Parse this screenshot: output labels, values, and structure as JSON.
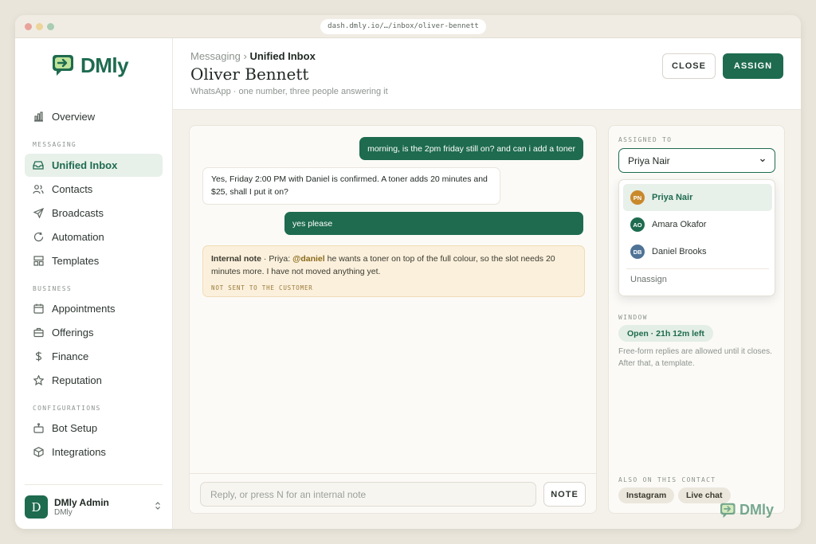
{
  "browser": {
    "url": "dash.dmly.io/…/inbox/oliver-bennett"
  },
  "brand": {
    "name": "DMly",
    "accent": "#1e6b4f"
  },
  "sidebar": {
    "top_items": [
      {
        "label": "Overview",
        "icon": "bar-chart-icon"
      }
    ],
    "sections": [
      {
        "label": "MESSAGING",
        "items": [
          {
            "label": "Unified Inbox",
            "icon": "inbox-icon",
            "active": true
          },
          {
            "label": "Contacts",
            "icon": "users-icon"
          },
          {
            "label": "Broadcasts",
            "icon": "send-icon"
          },
          {
            "label": "Automation",
            "icon": "refresh-icon"
          },
          {
            "label": "Templates",
            "icon": "layout-icon"
          }
        ]
      },
      {
        "label": "BUSINESS",
        "items": [
          {
            "label": "Appointments",
            "icon": "calendar-icon"
          },
          {
            "label": "Offerings",
            "icon": "briefcase-icon"
          },
          {
            "label": "Finance",
            "icon": "dollar-icon"
          },
          {
            "label": "Reputation",
            "icon": "star-icon"
          }
        ]
      },
      {
        "label": "CONFIGURATIONS",
        "items": [
          {
            "label": "Bot Setup",
            "icon": "bot-icon"
          },
          {
            "label": "Integrations",
            "icon": "cube-icon"
          }
        ]
      }
    ],
    "user": {
      "initial": "D",
      "name": "DMly Admin",
      "org": "DMly"
    }
  },
  "header": {
    "breadcrumb_parent": "Messaging",
    "breadcrumb_sep": "›",
    "breadcrumb_current": "Unified Inbox",
    "title": "Oliver Bennett",
    "subtitle": "WhatsApp · one number, three people answering it",
    "close_label": "CLOSE",
    "assign_label": "ASSIGN"
  },
  "chat": {
    "messages": [
      {
        "direction": "out",
        "text": "morning, is the 2pm friday still on? and can i add a toner"
      },
      {
        "direction": "in",
        "text": "Yes, Friday 2:00 PM with Daniel is confirmed. A toner adds 20 minutes and $25, shall I put it on?"
      },
      {
        "direction": "out",
        "text": "yes please"
      }
    ],
    "note": {
      "label": "Internal note",
      "prefix": " · Priya: ",
      "mention": "@daniel",
      "text": " he wants a toner on top of the full colour, so the slot needs 20 minutes more. I have not moved anything yet.",
      "tag": "NOT SENT TO THE CUSTOMER"
    },
    "composer": {
      "placeholder": "Reply, or press N for an internal note",
      "note_label": "NOTE"
    }
  },
  "assign_panel": {
    "label": "ASSIGNED TO",
    "selected": "Priya Nair",
    "options": [
      {
        "initials": "PN",
        "name": "Priya Nair",
        "color": "#c9892b",
        "selected": true
      },
      {
        "initials": "AO",
        "name": "Amara Okafor",
        "color": "#1e6b4f"
      },
      {
        "initials": "DB",
        "name": "Daniel Brooks",
        "color": "#4f7396"
      }
    ],
    "unassign_label": "Unassign",
    "window_label": "WINDOW",
    "window_status": "Open · 21h 12m left",
    "window_help": "Free-form replies are allowed until it closes. After that, a template.",
    "also_label": "ALSO ON THIS CONTACT",
    "channels": [
      "Instagram",
      "Live chat"
    ]
  }
}
